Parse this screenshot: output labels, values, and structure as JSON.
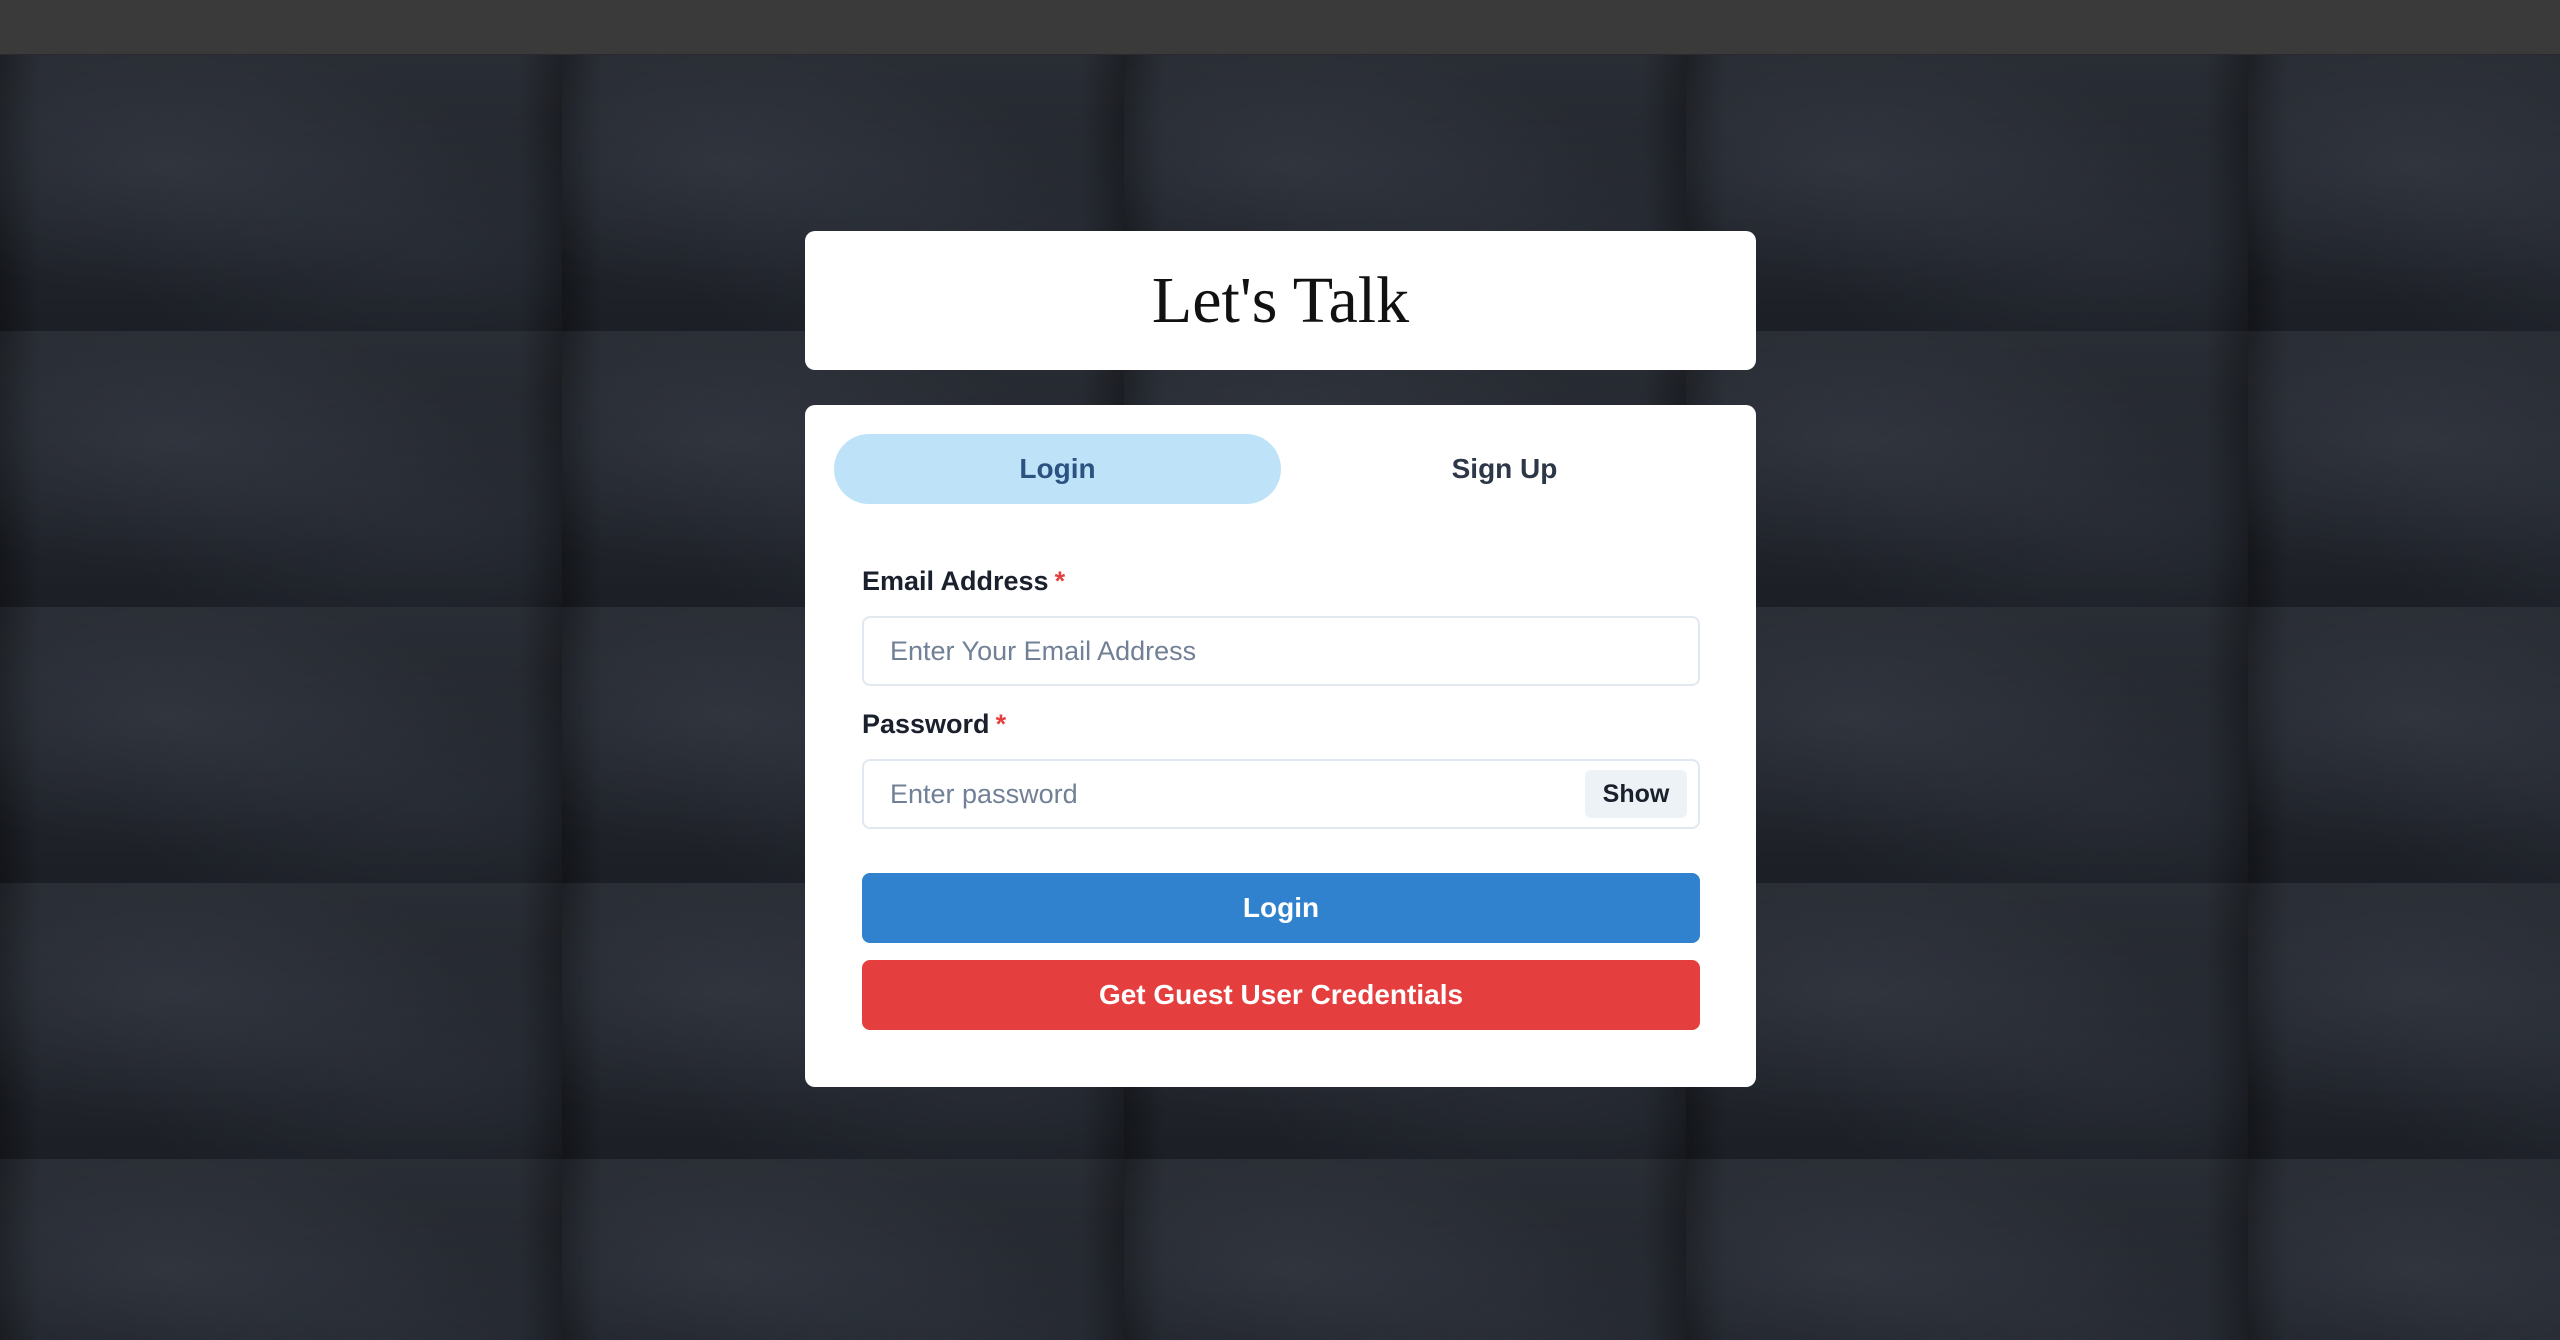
{
  "app": {
    "title": "Let's Talk"
  },
  "tabs": [
    {
      "label": "Login",
      "selected": true
    },
    {
      "label": "Sign Up",
      "selected": false
    }
  ],
  "form": {
    "email": {
      "label": "Email Address",
      "required_mark": "*",
      "placeholder": "Enter Your Email Address",
      "value": ""
    },
    "password": {
      "label": "Password",
      "required_mark": "*",
      "placeholder": "Enter password",
      "value": "",
      "toggle_label": "Show"
    }
  },
  "buttons": {
    "login": "Login",
    "guest": "Get Guest User Credentials"
  },
  "colors": {
    "tab_active_bg": "#bee3f8",
    "login_button": "#3182ce",
    "guest_button": "#e53e3e",
    "required_mark": "#e53e3e"
  }
}
